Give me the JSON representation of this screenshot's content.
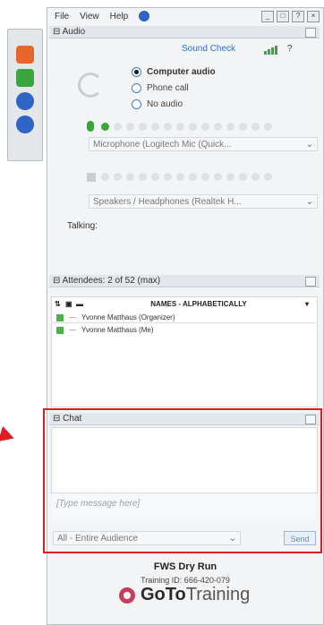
{
  "menu": [
    "File",
    "View",
    "Help"
  ],
  "window_controls": [
    "_",
    "□",
    "?",
    "×"
  ],
  "audio": {
    "section_label": "Audio",
    "sound_check": "Sound Check",
    "help": "?",
    "options": [
      {
        "label": "Computer audio",
        "selected": true
      },
      {
        "label": "Phone call",
        "selected": false
      },
      {
        "label": "No audio",
        "selected": false
      }
    ],
    "microphone": "Microphone (Logitech Mic (Quick...",
    "speakers": "Speakers / Headphones (Realtek H...",
    "talking_label": "Talking:"
  },
  "attendees": {
    "section_label": "Attendees: 2 of 52 (max)",
    "column_header": "NAMES - ALPHABETICALLY",
    "rows": [
      {
        "name": "Yvonne Matthaus (Organizer)"
      },
      {
        "name": "Yvonne Matthaus (Me)"
      }
    ]
  },
  "chat": {
    "section_label": "Chat",
    "placeholder": "[Type message here]",
    "recipient": "All - Entire Audience",
    "send_label": "Send"
  },
  "footer": {
    "session_title": "FWS Dry Run",
    "training_id": "Training ID: 666-420-079",
    "logo_bold": "GoTo",
    "logo_light": "Training"
  },
  "colors": {
    "highlight_red": "#e01b24",
    "status_green": "#49b34a",
    "link_blue": "#2a6fc9"
  }
}
